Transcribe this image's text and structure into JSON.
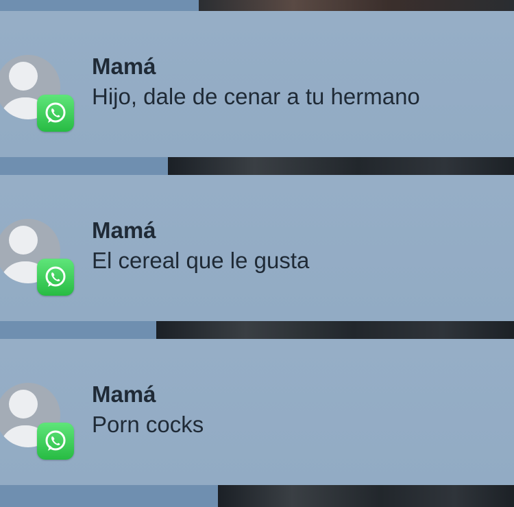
{
  "notifications": [
    {
      "sender": "Mamá",
      "message": "Hijo, dale de cenar a tu hermano",
      "app_icon": "whatsapp-icon",
      "avatar_icon": "default-contact-icon"
    },
    {
      "sender": "Mamá",
      "message": "El cereal que le gusta",
      "app_icon": "whatsapp-icon",
      "avatar_icon": "default-contact-icon"
    },
    {
      "sender": "Mamá",
      "message": "Porn cocks",
      "app_icon": "whatsapp-icon",
      "avatar_icon": "default-contact-icon"
    }
  ],
  "colors": {
    "notification_bg": "#96aec6",
    "text": "#1f2a36",
    "whatsapp_green": "#27bb43"
  }
}
